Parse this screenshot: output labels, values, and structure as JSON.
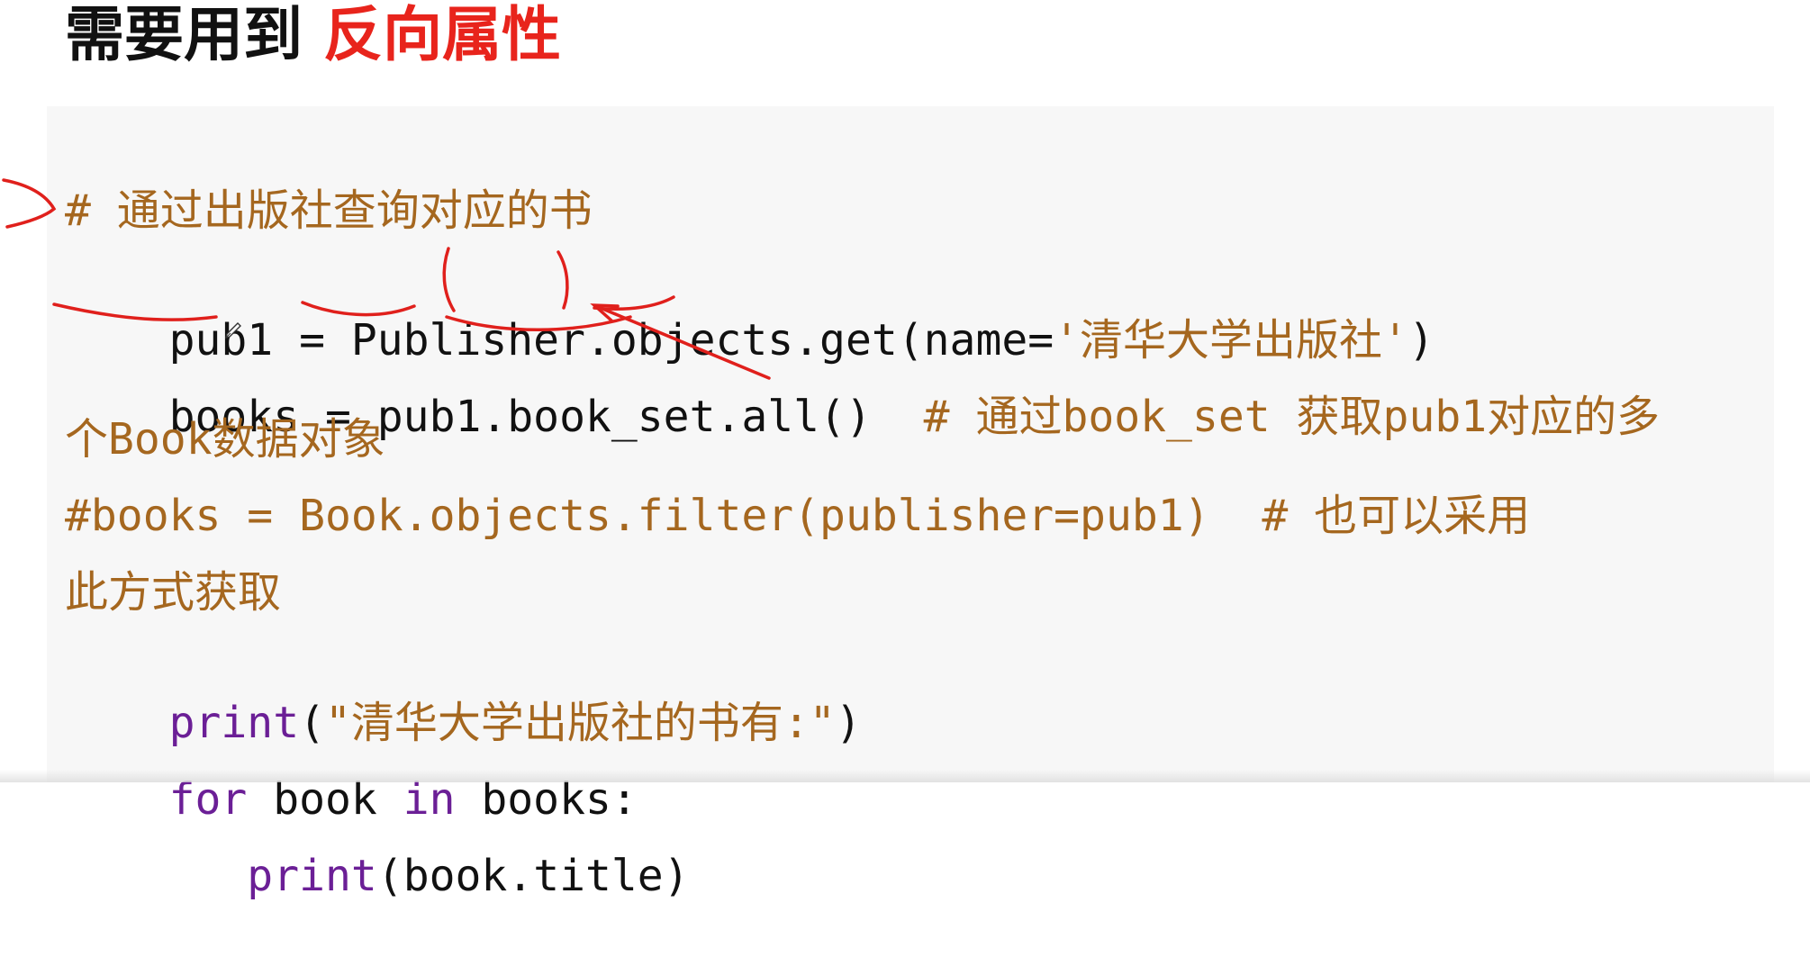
{
  "slide": {
    "title_part1": "需要用到 ",
    "title_part2": "反向属性"
  },
  "code": {
    "line1": "# 通过出版社查询对应的书",
    "line2_a": "pub1 = Publisher.objects.get(name=",
    "line2_str": "'清华大学出版社'",
    "line2_b": ")",
    "line3_code": "books = pub1.book_set.all()  ",
    "line3_comment": "# 通过book_set 获取pub1对应的多",
    "line4": "个Book数据对象",
    "line5": "#books = Book.objects.filter(publisher=pub1)  # 也可以采用",
    "line6": "此方式获取",
    "line7_kw": "print",
    "line7_a": "(",
    "line7_str": "\"清华大学出版社的书有:\"",
    "line7_b": ")",
    "line8_kw1": "for",
    "line8_a": " book ",
    "line8_kw2": "in",
    "line8_b": " books:",
    "line9_indent": "   ",
    "line9_kw": "print",
    "line9_rest": "(book.title)"
  },
  "icons": [
    "pen-cursor-icon"
  ],
  "colors": {
    "title_highlight": "#e8241c",
    "comment": "#a5671f",
    "keyword": "#6b1f96",
    "annotation": "#e0201c",
    "code_background": "#f7f7f7"
  }
}
